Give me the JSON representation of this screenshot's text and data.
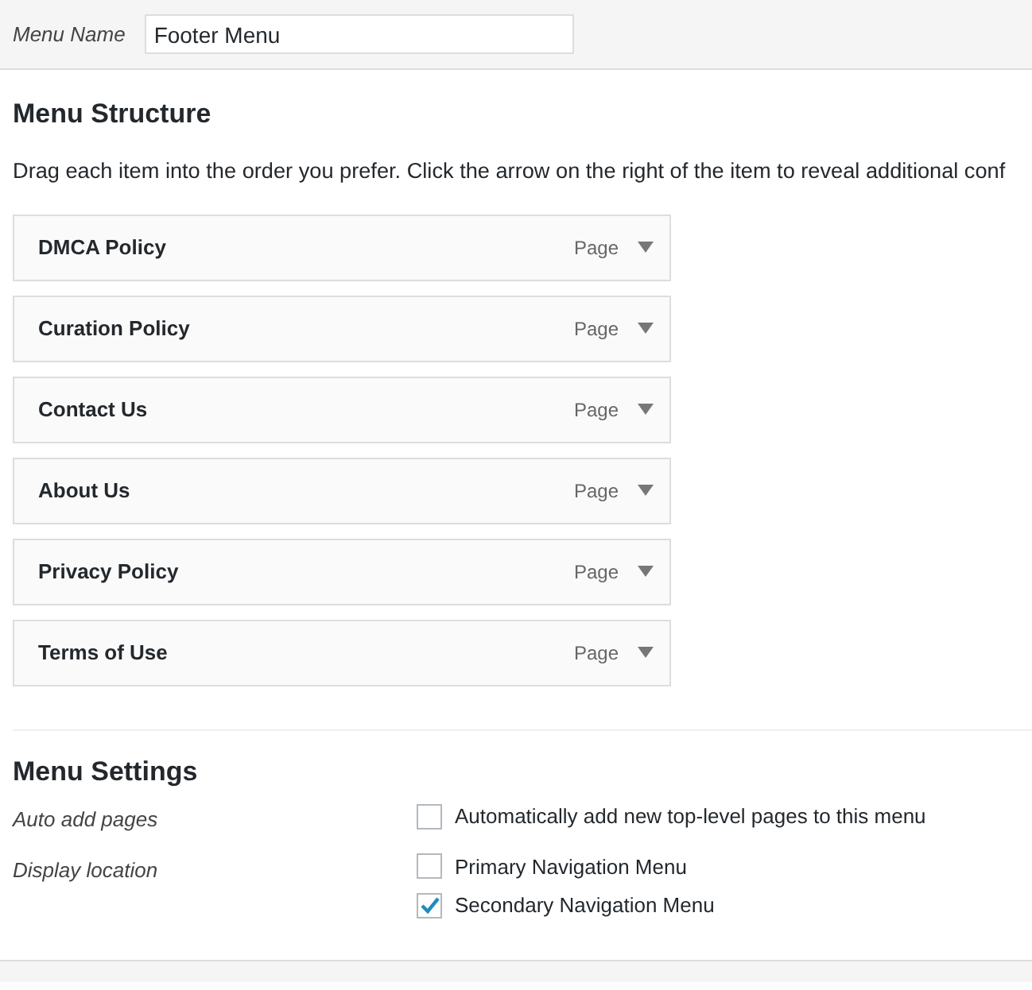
{
  "menu_name": {
    "label": "Menu Name",
    "value": "Footer Menu"
  },
  "structure": {
    "title": "Menu Structure",
    "description": "Drag each item into the order you prefer. Click the arrow on the right of the item to reveal additional conf",
    "items": [
      {
        "title": "DMCA Policy",
        "type": "Page"
      },
      {
        "title": "Curation Policy",
        "type": "Page"
      },
      {
        "title": "Contact Us",
        "type": "Page"
      },
      {
        "title": "About Us",
        "type": "Page"
      },
      {
        "title": "Privacy Policy",
        "type": "Page"
      },
      {
        "title": "Terms of Use",
        "type": "Page"
      }
    ]
  },
  "settings": {
    "title": "Menu Settings",
    "groups": [
      {
        "label": "Auto add pages",
        "options": [
          {
            "label": "Automatically add new top-level pages to this menu",
            "checked": false
          }
        ]
      },
      {
        "label": "Display location",
        "options": [
          {
            "label": "Primary Navigation Menu",
            "checked": false
          },
          {
            "label": "Secondary Navigation Menu",
            "checked": true
          }
        ]
      }
    ]
  }
}
